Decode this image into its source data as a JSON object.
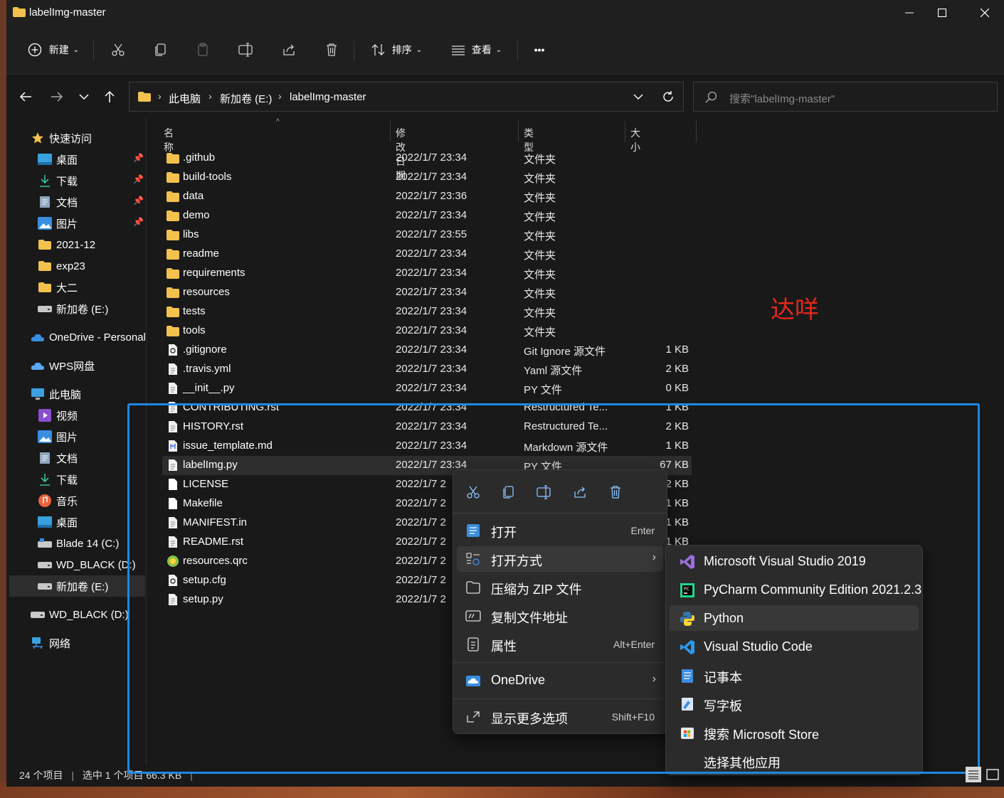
{
  "window": {
    "title": "labelImg-master"
  },
  "toolbar": {
    "new_label": "新建",
    "sort_label": "排序",
    "view_label": "查看",
    "more_label": "•••"
  },
  "address": {
    "crumbs": [
      "此电脑",
      "新加卷 (E:)",
      "labelImg-master"
    ]
  },
  "search": {
    "placeholder": "搜索\"labelImg-master\""
  },
  "sidebar": {
    "quick_access": "快速访问",
    "items": [
      {
        "label": "桌面",
        "icon": "desktop-icon",
        "pinned": true
      },
      {
        "label": "下载",
        "icon": "download-icon",
        "pinned": true
      },
      {
        "label": "文档",
        "icon": "document-icon",
        "pinned": true
      },
      {
        "label": "图片",
        "icon": "pictures-icon",
        "pinned": true
      },
      {
        "label": "2021-12",
        "icon": "folder-icon"
      },
      {
        "label": "exp23",
        "icon": "folder-icon"
      },
      {
        "label": "大二",
        "icon": "folder-icon"
      },
      {
        "label": "新加卷 (E:)",
        "icon": "drive-icon"
      }
    ],
    "onedrive": "OneDrive - Personal",
    "wps": "WPS网盘",
    "this_pc": "此电脑",
    "pc_items": [
      {
        "label": "视频",
        "icon": "videos-icon"
      },
      {
        "label": "图片",
        "icon": "pictures-icon"
      },
      {
        "label": "文档",
        "icon": "document-icon"
      },
      {
        "label": "下载",
        "icon": "download-icon"
      },
      {
        "label": "音乐",
        "icon": "music-icon"
      },
      {
        "label": "桌面",
        "icon": "desktop-icon"
      },
      {
        "label": "Blade 14 (C:)",
        "icon": "drive-icon"
      },
      {
        "label": "WD_BLACK (D:)",
        "icon": "drive-icon"
      },
      {
        "label": "新加卷 (E:)",
        "icon": "drive-icon",
        "selected": true
      }
    ],
    "wd_black": "WD_BLACK (D:)",
    "network": "网络"
  },
  "columns": {
    "name": "名称",
    "date": "修改日期",
    "type": "类型",
    "size": "大小"
  },
  "files": [
    {
      "name": ".github",
      "date": "2022/1/7 23:34",
      "type": "文件夹",
      "size": "",
      "icon": "folder"
    },
    {
      "name": "build-tools",
      "date": "2022/1/7 23:34",
      "type": "文件夹",
      "size": "",
      "icon": "folder"
    },
    {
      "name": "data",
      "date": "2022/1/7 23:36",
      "type": "文件夹",
      "size": "",
      "icon": "folder"
    },
    {
      "name": "demo",
      "date": "2022/1/7 23:34",
      "type": "文件夹",
      "size": "",
      "icon": "folder"
    },
    {
      "name": "libs",
      "date": "2022/1/7 23:55",
      "type": "文件夹",
      "size": "",
      "icon": "folder"
    },
    {
      "name": "readme",
      "date": "2022/1/7 23:34",
      "type": "文件夹",
      "size": "",
      "icon": "folder"
    },
    {
      "name": "requirements",
      "date": "2022/1/7 23:34",
      "type": "文件夹",
      "size": "",
      "icon": "folder"
    },
    {
      "name": "resources",
      "date": "2022/1/7 23:34",
      "type": "文件夹",
      "size": "",
      "icon": "folder"
    },
    {
      "name": "tests",
      "date": "2022/1/7 23:34",
      "type": "文件夹",
      "size": "",
      "icon": "folder"
    },
    {
      "name": "tools",
      "date": "2022/1/7 23:34",
      "type": "文件夹",
      "size": "",
      "icon": "folder"
    },
    {
      "name": ".gitignore",
      "date": "2022/1/7 23:34",
      "type": "Git Ignore 源文件",
      "size": "1 KB",
      "icon": "gear-file"
    },
    {
      "name": ".travis.yml",
      "date": "2022/1/7 23:34",
      "type": "Yaml 源文件",
      "size": "2 KB",
      "icon": "file"
    },
    {
      "name": "__init__.py",
      "date": "2022/1/7 23:34",
      "type": "PY 文件",
      "size": "0 KB",
      "icon": "file"
    },
    {
      "name": "CONTRIBUTING.rst",
      "date": "2022/1/7 23:34",
      "type": "Restructured Te...",
      "size": "1 KB",
      "icon": "file"
    },
    {
      "name": "HISTORY.rst",
      "date": "2022/1/7 23:34",
      "type": "Restructured Te...",
      "size": "2 KB",
      "icon": "file"
    },
    {
      "name": "issue_template.md",
      "date": "2022/1/7 23:34",
      "type": "Markdown 源文件",
      "size": "1 KB",
      "icon": "md-file"
    },
    {
      "name": "labelImg.py",
      "date": "2022/1/7 23:34",
      "type": "PY 文件",
      "size": "67 KB",
      "icon": "file",
      "selected": true
    },
    {
      "name": "LICENSE",
      "date": "2022/1/7 2",
      "type": "",
      "size": "2 KB",
      "icon": "blank-file"
    },
    {
      "name": "Makefile",
      "date": "2022/1/7 2",
      "type": "",
      "size": "1 KB",
      "icon": "blank-file"
    },
    {
      "name": "MANIFEST.in",
      "date": "2022/1/7 2",
      "type": "",
      "size": "1 KB",
      "icon": "file"
    },
    {
      "name": "README.rst",
      "date": "2022/1/7 2",
      "type": "",
      "size": "1 KB",
      "icon": "file"
    },
    {
      "name": "resources.qrc",
      "date": "2022/1/7 2",
      "type": "",
      "size": "",
      "icon": "qrc-file"
    },
    {
      "name": "setup.cfg",
      "date": "2022/1/7 2",
      "type": "",
      "size": "",
      "icon": "gear-file"
    },
    {
      "name": "setup.py",
      "date": "2022/1/7 2",
      "type": "",
      "size": "",
      "icon": "file"
    }
  ],
  "annotation": "达咩",
  "context_menu": {
    "items": [
      {
        "label": "打开",
        "shortcut": "Enter",
        "icon": "open-icon"
      },
      {
        "label": "打开方式",
        "shortcut": "",
        "icon": "open-with-icon",
        "submenu": true
      },
      {
        "label": "压缩为 ZIP 文件",
        "shortcut": "",
        "icon": "zip-icon"
      },
      {
        "label": "复制文件地址",
        "shortcut": "",
        "icon": "copy-path-icon"
      },
      {
        "label": "属性",
        "shortcut": "Alt+Enter",
        "icon": "properties-icon"
      }
    ],
    "onedrive": "OneDrive",
    "more": "显示更多选项",
    "more_shortcut": "Shift+F10"
  },
  "open_with": {
    "items": [
      {
        "label": "Microsoft Visual Studio 2019",
        "icon": "visual-studio-icon"
      },
      {
        "label": "PyCharm Community Edition 2021.2.3",
        "icon": "pycharm-icon"
      },
      {
        "label": "Python",
        "icon": "python-icon"
      },
      {
        "label": "Visual Studio Code",
        "icon": "vscode-icon"
      },
      {
        "label": "记事本",
        "icon": "notepad-icon"
      },
      {
        "label": "写字板",
        "icon": "wordpad-icon"
      },
      {
        "label": "搜索 Microsoft Store",
        "icon": "store-icon"
      },
      {
        "label": "选择其他应用",
        "icon": ""
      }
    ]
  },
  "status": {
    "count": "24 个项目",
    "selection": "选中 1 个项目  66.3 KB"
  },
  "colors": {
    "accent": "#1e88e5",
    "folder": "#f2c14e",
    "annotation": "#e4281c"
  }
}
